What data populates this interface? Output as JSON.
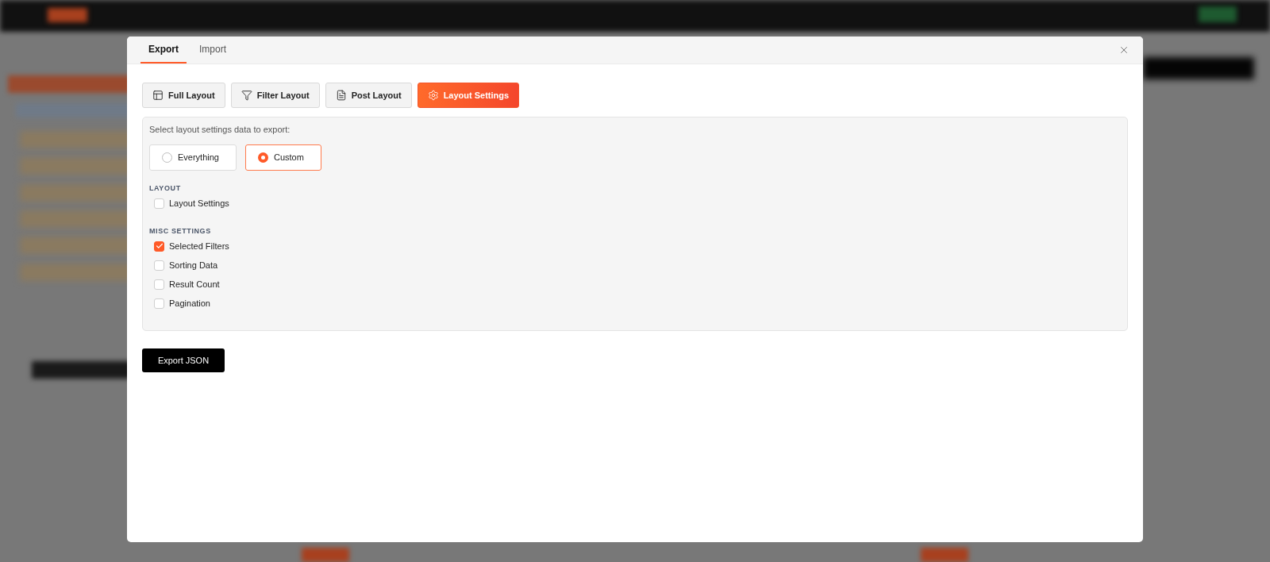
{
  "dialog": {
    "tabs": [
      {
        "label": "Export",
        "selected": true
      },
      {
        "label": "Import",
        "selected": false
      }
    ],
    "export_types": [
      {
        "label": "Full Layout",
        "kind": "layout",
        "selected": false
      },
      {
        "label": "Filter Layout",
        "kind": "filter",
        "selected": false
      },
      {
        "label": "Post Layout",
        "kind": "post",
        "selected": false
      },
      {
        "label": "Layout Settings",
        "kind": "settings",
        "selected": true
      }
    ],
    "settings_panel": {
      "prompt": "Select layout settings data to export:",
      "scope_options": [
        {
          "label": "Everything",
          "selected": false
        },
        {
          "label": "Custom",
          "selected": true
        }
      ],
      "groups": [
        {
          "heading": "LAYOUT",
          "items": [
            {
              "label": "Layout Settings",
              "checked": false
            }
          ]
        },
        {
          "heading": "MISC SETTINGS",
          "items": [
            {
              "label": "Selected Filters",
              "checked": true
            },
            {
              "label": "Sorting Data",
              "checked": false
            },
            {
              "label": "Result Count",
              "checked": false
            },
            {
              "label": "Pagination",
              "checked": false
            }
          ]
        }
      ]
    },
    "export_button": "Export JSON"
  }
}
